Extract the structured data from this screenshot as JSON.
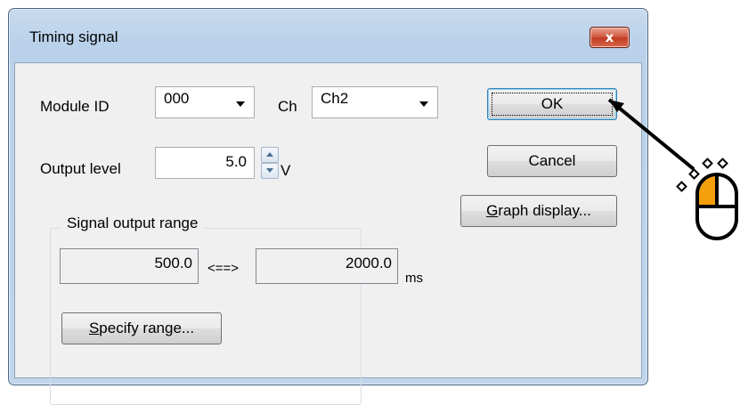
{
  "dialog": {
    "title": "Timing signal",
    "close_glyph": "x"
  },
  "module": {
    "label": "Module ID",
    "value": "000"
  },
  "channel": {
    "label": "Ch",
    "value": "Ch2"
  },
  "output_level": {
    "label": "Output level",
    "value": "5.0",
    "unit": "V"
  },
  "range_group": {
    "title": "Signal output range",
    "from_value": "500.0",
    "separator": "<==>",
    "to_value": "2000.0",
    "unit": "ms",
    "specify_button_accel": "S",
    "specify_button_rest": "pecify range..."
  },
  "buttons": {
    "ok": "OK",
    "cancel": "Cancel",
    "graph_accel": "G",
    "graph_rest": "raph display..."
  },
  "icons": {
    "pointer": "mouse-click-icon"
  }
}
